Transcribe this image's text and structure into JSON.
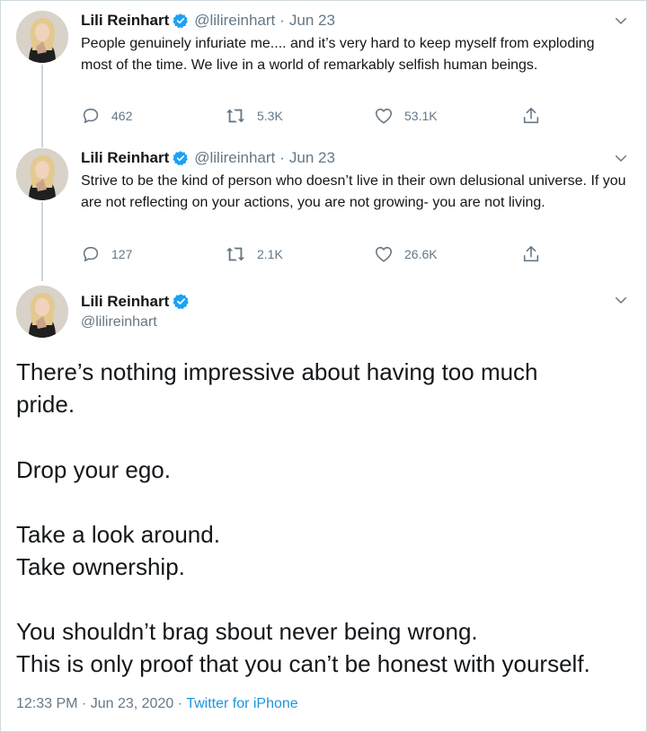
{
  "author": {
    "name": "Lili Reinhart",
    "handle": "@lilireinhart"
  },
  "tweets": [
    {
      "date": "Jun 23",
      "text": "People genuinely infuriate me.... and it’s very hard to keep myself from exploding most of the time. We live in a world of remarkably selfish human beings.",
      "replies": "462",
      "retweets": "5.3K",
      "likes": "53.1K"
    },
    {
      "date": "Jun 23",
      "text": "Strive to be the kind of person who doesn’t live in their own delusional universe. If you are not reflecting on your actions, you are not growing- you are not living.",
      "replies": "127",
      "retweets": "2.1K",
      "likes": "26.6K"
    }
  ],
  "main_tweet": {
    "lines": [
      "There’s nothing impressive about having too much pride.",
      "Drop your ego.",
      "Take a look around.",
      "Take ownership.",
      "You shouldn’t brag sbout never being wrong.",
      "This is only proof that you can’t be honest with yourself."
    ],
    "time": "12:33 PM",
    "full_date": "Jun 23, 2020",
    "separator": "·",
    "source": "Twitter for iPhone"
  },
  "icons": {
    "verified": "verified-badge-icon",
    "reply": "reply-icon",
    "retweet": "retweet-icon",
    "like": "heart-icon",
    "share": "share-icon",
    "more": "chevron-down-icon"
  },
  "colors": {
    "accent": "#1da1f2",
    "link": "#1b95e0",
    "muted": "#657786",
    "text": "#14171a"
  }
}
